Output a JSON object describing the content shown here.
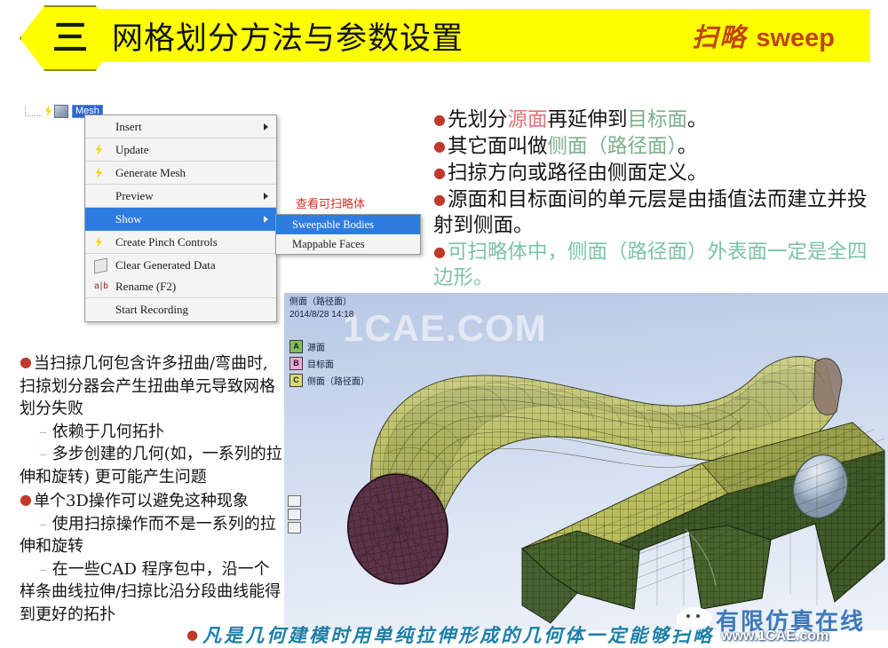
{
  "header": {
    "section_number": "三",
    "title": "网格划分方法与参数设置",
    "subtitle_cn": "扫略",
    "subtitle_en": "sweep"
  },
  "tree": {
    "node_label": "Mesh"
  },
  "context_menu": {
    "items": [
      {
        "label": "Insert",
        "has_submenu": true,
        "icon": "none",
        "selected": false
      },
      {
        "label": "Update",
        "has_submenu": false,
        "icon": "lightning-icon",
        "selected": false
      },
      {
        "label": "Generate Mesh",
        "has_submenu": false,
        "icon": "lightning-icon",
        "selected": false
      },
      {
        "label": "Preview",
        "has_submenu": true,
        "icon": "none",
        "selected": false
      },
      {
        "label": "Show",
        "has_submenu": true,
        "icon": "none",
        "selected": true
      },
      {
        "label": "Create Pinch Controls",
        "has_submenu": false,
        "icon": "lightning-icon",
        "selected": false
      },
      {
        "label": "Clear Generated Data",
        "has_submenu": false,
        "icon": "eraser-icon",
        "selected": false
      },
      {
        "label": "Rename (F2)",
        "has_submenu": false,
        "icon": "rename-icon",
        "selected": false
      },
      {
        "label": "Start Recording",
        "has_submenu": false,
        "icon": "none",
        "selected": false
      }
    ]
  },
  "submenu": {
    "annotation": "查看可扫略体",
    "items": [
      {
        "label": "Sweepable Bodies",
        "selected": true
      },
      {
        "label": "Mappable Faces",
        "selected": false
      }
    ]
  },
  "right_bullets": [
    {
      "parts": [
        {
          "t": "先划分",
          "c": "black"
        },
        {
          "t": "源面",
          "c": "source"
        },
        {
          "t": "再延伸到",
          "c": "black"
        },
        {
          "t": "目标面",
          "c": "target"
        },
        {
          "t": "。",
          "c": "black"
        }
      ]
    },
    {
      "parts": [
        {
          "t": "其它面叫做",
          "c": "black"
        },
        {
          "t": "侧面（路径面）",
          "c": "side"
        },
        {
          "t": "。",
          "c": "black"
        }
      ]
    },
    {
      "parts": [
        {
          "t": "扫掠方向或路径由侧面定义。",
          "c": "black"
        }
      ]
    },
    {
      "parts": [
        {
          "t": "源面和目标面间的单元层是由插值法而建立并投射到侧面。",
          "c": "black"
        }
      ]
    },
    {
      "parts": [
        {
          "t": "可扫略体中，侧面（路径面）外表面一定是全四边形。",
          "c": "green"
        }
      ]
    }
  ],
  "left_bullets": [
    {
      "level": "top",
      "text": "当扫掠几何包含许多扭曲/弯曲时, 扫掠划分器会产生扭曲单元导致网格划分失败"
    },
    {
      "level": "sub",
      "text": "依赖于几何拓扑"
    },
    {
      "level": "sub",
      "text": "多步创建的几何(如，一系列的拉伸和旋转) 更可能产生问题"
    },
    {
      "level": "top",
      "text": "单个3D操作可以避免这种现象"
    },
    {
      "level": "sub",
      "text": "使用扫掠操作而不是一系列的拉伸和旋转"
    },
    {
      "level": "sub",
      "text": "在一些CAD 程序包中，沿一个样条曲线拉伸/扫掠比沿分段曲线能得到更好的拓扑"
    }
  ],
  "viewport": {
    "title": "侧面（路径面）",
    "date": "2014/8/28 14:18",
    "watermark": "1CAE.COM",
    "legend": [
      {
        "key": "A",
        "label": "源面",
        "color": "#7fbf5a"
      },
      {
        "key": "B",
        "label": "目标面",
        "color": "#f0a8d8"
      },
      {
        "key": "C",
        "label": "侧面（路径面）",
        "color": "#d8d87a"
      }
    ]
  },
  "bottom_note": {
    "text": "凡是几何建模时用单纯拉伸形成的几何体一定能够扫略"
  },
  "brand": {
    "name": "有限仿真在线",
    "url": "www.1CAE.com"
  },
  "colors": {
    "banner": "#ffff00",
    "accent_red": "#c1440e",
    "menu_select": "#2f7ce0",
    "annotation_red": "#d93025",
    "source_face": "#e0737a",
    "target_face": "#7cb08a",
    "green_text": "#7cc3a4",
    "note_blue": "#1b7fa8"
  }
}
